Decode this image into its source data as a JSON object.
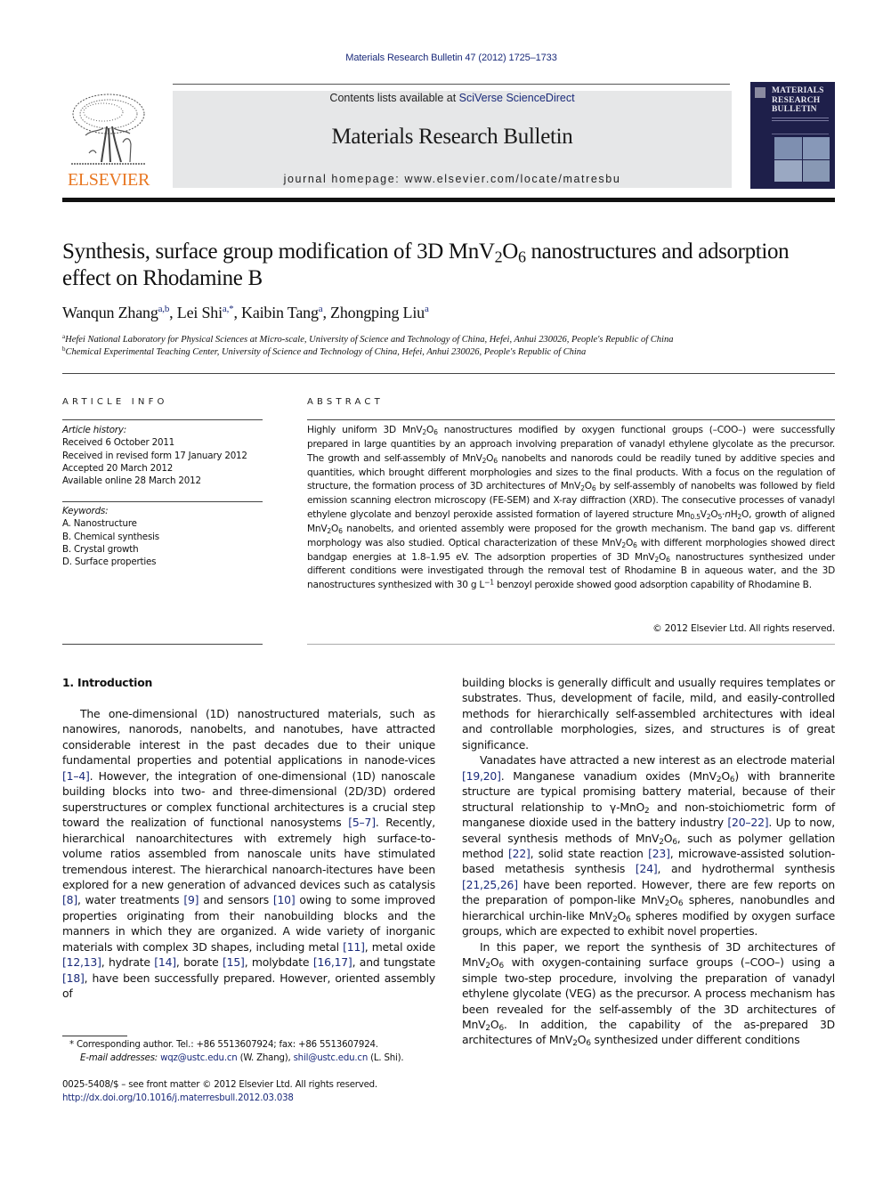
{
  "header": {
    "citation": "Materials Research Bulletin 47 (2012) 1725–1733",
    "publisher_logo_icon": "elsevier-tree-icon",
    "publisher_wordmark": "ELSEVIER",
    "contents_prefix": "Contents lists available at ",
    "contents_link": "SciVerse ScienceDirect",
    "journal_name": "Materials Research Bulletin",
    "homepage_label": "journal homepage: ",
    "homepage_url": "www.elsevier.com/locate/matresbu",
    "cover_title_lines": [
      "MATERIALS",
      "RESEARCH",
      "BULLETIN"
    ],
    "cover_icon": "journal-cover-icon"
  },
  "article": {
    "title_html": "Synthesis, surface group modification of 3D MnV<sub>2</sub>O<sub>6</sub> nanostructures and adsorption effect on Rhodamine B",
    "authors": [
      {
        "name": "Wanqun Zhang",
        "marks": "a,b"
      },
      {
        "name": "Lei Shi",
        "marks": "a,*"
      },
      {
        "name": "Kaibin Tang",
        "marks": "a"
      },
      {
        "name": "Zhongping Liu",
        "marks": "a"
      }
    ],
    "affiliations": [
      {
        "mark": "a",
        "text": "Hefei National Laboratory for Physical Sciences at Micro-scale, University of Science and Technology of China, Hefei, Anhui 230026, People's Republic of China"
      },
      {
        "mark": "b",
        "text": "Chemical Experimental Teaching Center, University of Science and Technology of China, Hefei, Anhui 230026, People's Republic of China"
      }
    ]
  },
  "article_info": {
    "heading": "ARTICLE INFO",
    "history_label": "Article history:",
    "history": [
      "Received 6 October 2011",
      "Received in revised form 17 January 2012",
      "Accepted 20 March 2012",
      "Available online 28 March 2012"
    ],
    "keywords_label": "Keywords:",
    "keywords": [
      "A. Nanostructure",
      "B. Chemical synthesis",
      "B. Crystal growth",
      "D. Surface properties"
    ]
  },
  "abstract": {
    "heading": "ABSTRACT",
    "body_html": "Highly uniform 3D MnV<sub>2</sub>O<sub>6</sub> nanostructures modified by oxygen functional groups (–COO–) were successfully prepared in large quantities by an approach involving preparation of vanadyl ethylene glycolate as the precursor. The growth and self-assembly of MnV<sub>2</sub>O<sub>6</sub> nanobelts and nanorods could be readily tuned by additive species and quantities, which brought different morphologies and sizes to the final products. With a focus on the regulation of structure, the formation process of 3D architectures of MnV<sub>2</sub>O<sub>6</sub> by self-assembly of nanobelts was followed by field emission scanning electron microscopy (FE-SEM) and X-ray diffraction (XRD). The consecutive processes of vanadyl ethylene glycolate and benzoyl peroxide assisted formation of layered structure Mn<sub>0.5</sub>V<sub>2</sub>O<sub>5</sub>·<i>n</i>H<sub>2</sub>O, growth of aligned MnV<sub>2</sub>O<sub>6</sub> nanobelts, and oriented assembly were proposed for the growth mechanism. The band gap vs. different morphology was also studied. Optical characterization of these MnV<sub>2</sub>O<sub>6</sub> with different morphologies showed direct bandgap energies at 1.8–1.95 eV. The adsorption properties of 3D MnV<sub>2</sub>O<sub>6</sub> nanostructures synthesized under different conditions were investigated through the removal test of Rhodamine B in aqueous water, and the 3D nanostructures synthesized with 30 g L<sup>−1</sup> benzoyl peroxide showed good adsorption capability of Rhodamine B.",
    "copyright": "© 2012 Elsevier Ltd. All rights reserved."
  },
  "body": {
    "section_heading": "1. Introduction",
    "left_column_html": "<p>The one-dimensional (1D) nanostructured materials, such as nanowires, nanorods, nanobelts, and nanotubes, have attracted considerable interest in the past decades due to their unique fundamental properties and potential applications in nanode-vices <span class=\"cite\">[1–4]</span>. However, the integration of one-dimensional (1D) nanoscale building blocks into two- and three-dimensional (2D/3D) ordered superstructures or complex functional architectures is a crucial step toward the realization of functional nanosystems <span class=\"cite\">[5–7]</span>. Recently, hierarchical nanoarchitectures with extremely high surface-to-volume ratios assembled from nanoscale units have stimulated tremendous interest. The hierarchical nanoarch-itectures have been explored for a new generation of advanced devices such as catalysis <span class=\"cite\">[8]</span>, water treatments <span class=\"cite\">[9]</span> and sensors <span class=\"cite\">[10]</span> owing to some improved properties originating from their nanobuilding blocks and the manners in which they are organized. A wide variety of inorganic materials with complex 3D shapes, including metal <span class=\"cite\">[11]</span>, metal oxide <span class=\"cite\">[12,13]</span>, hydrate <span class=\"cite\">[14]</span>, borate <span class=\"cite\">[15]</span>, molybdate <span class=\"cite\">[16,17]</span>, and tungstate <span class=\"cite\">[18]</span>, have been successfully prepared. However, oriented assembly of</p>",
    "right_column_html": "<p class=\"noindent\">building blocks is generally difficult and usually requires templates or substrates. Thus, development of facile, mild, and easily-controlled methods for hierarchically self-assembled architectures with ideal and controllable morphologies, sizes, and structures is of great significance.</p><p>Vanadates have attracted a new interest as an electrode material <span class=\"cite\">[19,20]</span>. Manganese vanadium oxides (MnV<sub>2</sub>O<sub>6</sub>) with brannerite structure are typical promising battery material, because of their structural relationship to γ-MnO<sub>2</sub> and non-stoichiometric form of manganese dioxide used in the battery industry <span class=\"cite\">[20–22]</span>. Up to now, several synthesis methods of MnV<sub>2</sub>O<sub>6</sub>, such as polymer gellation method <span class=\"cite\">[22]</span>, solid state reaction <span class=\"cite\">[23]</span>, microwave-assisted solution-based metathesis synthesis <span class=\"cite\">[24]</span>, and hydrothermal synthesis <span class=\"cite\">[21,25,26]</span> have been reported. However, there are few reports on the preparation of pompon-like MnV<sub>2</sub>O<sub>6</sub> spheres, nanobundles and hierarchical urchin-like MnV<sub>2</sub>O<sub>6</sub> spheres modified by oxygen surface groups, which are expected to exhibit novel properties.</p><p>In this paper, we report the synthesis of 3D architectures of MnV<sub>2</sub>O<sub>6</sub> with oxygen-containing surface groups (–COO–) using a simple two-step procedure, involving the preparation of vanadyl ethylene glycolate (VEG) as the precursor. A process mechanism has been revealed for the self-assembly of the 3D architectures of MnV<sub>2</sub>O<sub>6</sub>. In addition, the capability of the as-prepared 3D architectures of MnV<sub>2</sub>O<sub>6</sub> synthesized under different conditions</p>"
  },
  "footnotes": {
    "corresponding_mark": "*",
    "corresponding_text": "Corresponding author. Tel.: +86 5513607924; fax: +86 5513607924.",
    "email_label": "E-mail addresses:",
    "emails": [
      {
        "address": "wqz@ustc.edu.cn",
        "owner": "(W. Zhang)"
      },
      {
        "address": "shil@ustc.edu.cn",
        "owner": "(L. Shi)."
      }
    ],
    "front_matter": "0025-5408/$ – see front matter © 2012 Elsevier Ltd. All rights reserved.",
    "doi_link": "http://dx.doi.org/10.1016/j.materresbull.2012.03.038"
  },
  "colors": {
    "link": "#1a2a7a",
    "elsevier_orange": "#e87722",
    "masthead_bg": "#e6e7e8",
    "cover_bg": "#1e1f4a"
  }
}
